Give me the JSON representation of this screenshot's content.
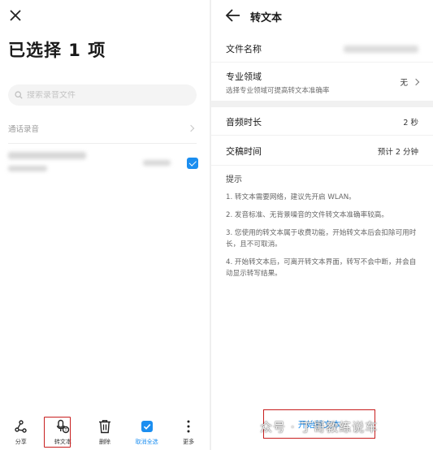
{
  "left": {
    "title": "已选择 1 项",
    "search_placeholder": "搜索录音文件",
    "section_label": "通话录音",
    "bottom_bar": [
      {
        "label": "分享",
        "icon": "share-icon"
      },
      {
        "label": "转文本",
        "icon": "transcribe-icon"
      },
      {
        "label": "删除",
        "icon": "trash-icon"
      },
      {
        "label": "取消全选",
        "icon": "select-all-icon"
      },
      {
        "label": "更多",
        "icon": "more-icon"
      }
    ]
  },
  "right": {
    "title": "转文本",
    "rows": {
      "file_name_label": "文件名称",
      "domain_label": "专业领域",
      "domain_sub": "选择专业领域可提高转文本准确率",
      "domain_value": "无",
      "duration_label": "音频时长",
      "duration_value": "2 秒",
      "delivery_label": "交稿时间",
      "delivery_value": "预计 2 分钟"
    },
    "tips_title": "提示",
    "tips": [
      "1. 转文本需要网络，建议先开启 WLAN。",
      "2. 发音标准、无背景噪音的文件转文本准确率较高。",
      "3. 您使用的转文本属于收费功能，开始转文本后会扣除可用时长，且不可取消。",
      "4. 开始转文本后，可离开转文本界面，转写不会中断，并会自动显示转写结果。"
    ],
    "start_button": "开始转文本"
  },
  "watermark": "众号 · 丁哥教练说车",
  "colors": {
    "accent": "#1b8ef0",
    "highlight": "#c81e1e"
  }
}
